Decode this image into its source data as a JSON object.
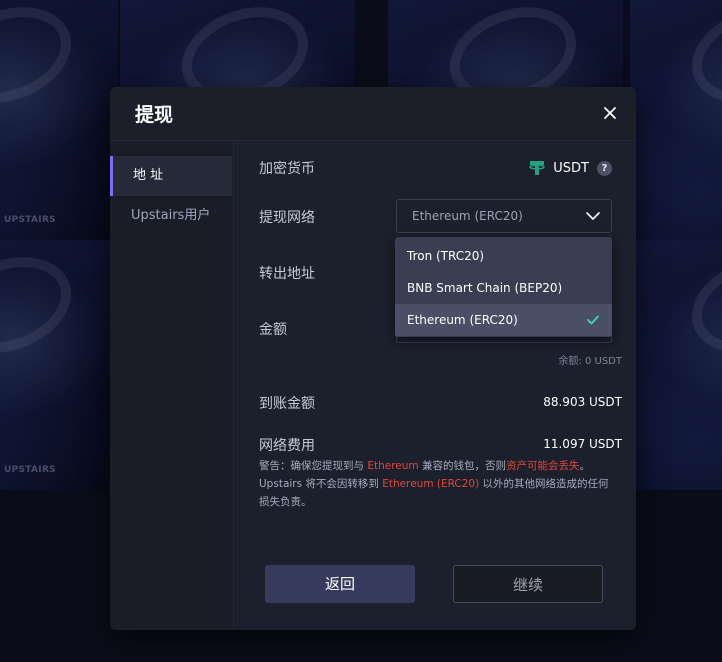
{
  "background": {
    "card_label": "UPSTAIRS"
  },
  "modal": {
    "title": "提现",
    "close_icon": "close-icon"
  },
  "sidebar": {
    "items": [
      {
        "label": "地 址",
        "active": true
      },
      {
        "label": "Upstairs用户",
        "active": false
      }
    ]
  },
  "form": {
    "currency_label": "加密货币",
    "currency_value": "USDT",
    "currency_icon": "tether-icon",
    "help_mark": "?",
    "network_label": "提现网络",
    "network_value": "Ethereum (ERC20)",
    "address_label": "转出地址",
    "amount_label": "金额",
    "balance_text": "余额: 0 USDT",
    "received_label": "到账金额",
    "received_value": "88.903 USDT",
    "fee_label": "网络费用",
    "fee_value": "11.097 USDT"
  },
  "dropdown": {
    "options": [
      {
        "label": "Tron (TRC20)",
        "selected": false
      },
      {
        "label": "BNB Smart Chain (BEP20)",
        "selected": false
      },
      {
        "label": "Ethereum (ERC20)",
        "selected": true
      }
    ]
  },
  "warning": {
    "p1": "警告：确保您提现到与 ",
    "p2": "Ethereum",
    "p3": " 兼容的钱包，否则",
    "p4": "资产可能会丢失",
    "p5": "。 Upstairs 将不会因转移到 ",
    "p6": "Ethereum (ERC20)",
    "p7": " 以外的其他网络造成的任何损失负责。"
  },
  "buttons": {
    "back_label": "返回",
    "continue_label": "继续"
  },
  "colors": {
    "accent": "#7f6df0",
    "warning_red": "#e0463a",
    "tether_green": "#26a17b",
    "check_green": "#3ddbb0"
  }
}
